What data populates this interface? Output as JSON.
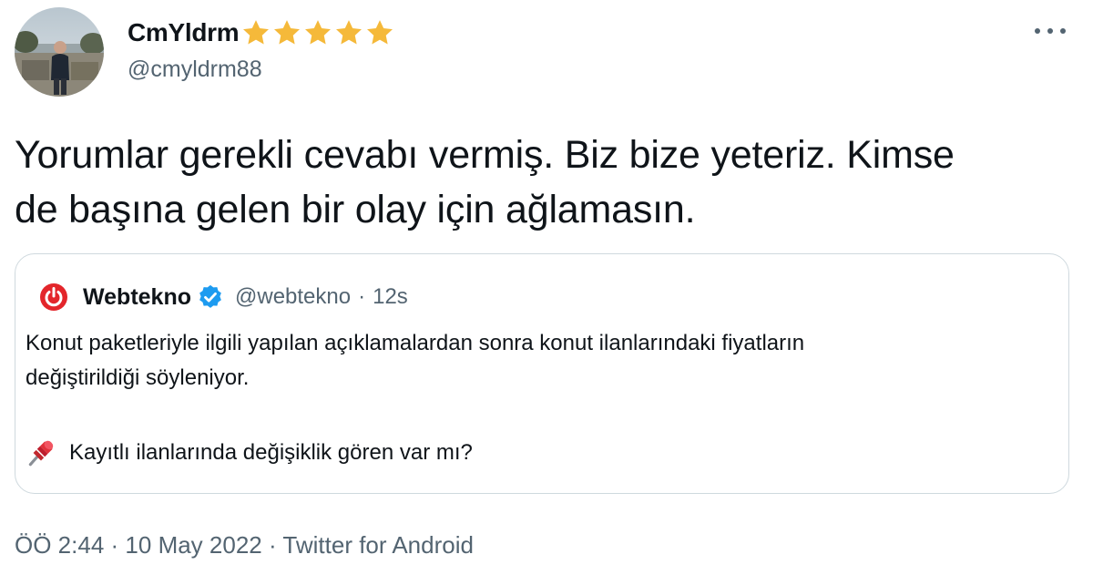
{
  "author": {
    "display_name": "CmYldrm",
    "handle": "@cmyldrm88",
    "badge_emoji": "⭐⭐⭐⭐⭐"
  },
  "tweet": {
    "text_line_1": "Yorumlar gerekli cevabı vermiş. Biz bize yeteriz. Kimse",
    "text_line_2": "de başına gelen bir olay için ağlamasın."
  },
  "quoted": {
    "name": "Webtekno",
    "handle": "@webtekno",
    "separator": "·",
    "time": "12s",
    "line_1": "Konut paketleriyle ilgili yapılan açıklamalardan sonra konut ilanlarındaki fiyatların",
    "line_2": "değiştirildiği söyleniyor.",
    "line_3": "Kayıtlı ilanlarında değişiklik gören var mı?",
    "verified": true
  },
  "footer": {
    "time": "ÖÖ 2:44",
    "sep1": "·",
    "date": "10 May 2022",
    "sep2": "·",
    "source": "Twitter for Android"
  },
  "colors": {
    "text": "#0f1419",
    "secondary": "#536471",
    "border": "#cfd9de",
    "star": "#f5b93a",
    "verified": "#1d9bf0",
    "webtekno_red": "#e3262b"
  },
  "icons": {
    "more": "more-horizontal-icon",
    "star": "star-icon",
    "verified": "verified-badge-icon",
    "logo": "webtekno-logo-icon",
    "pin": "pushpin-icon"
  }
}
